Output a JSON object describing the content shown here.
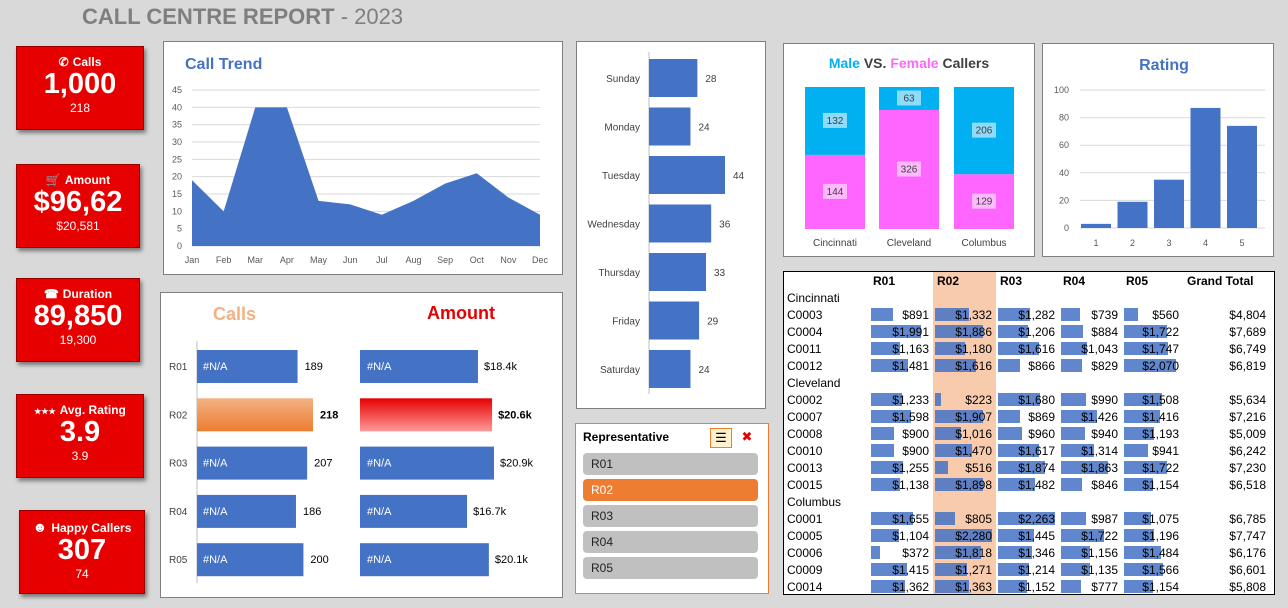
{
  "header": {
    "title": "CALL CENTRE REPORT",
    "sep": " - ",
    "year": "2023"
  },
  "kpis": [
    {
      "label": "Calls",
      "icon": "phone-icon",
      "glyph": "✆",
      "value": "1,000",
      "sub": "218"
    },
    {
      "label": "Amount",
      "icon": "cart-icon",
      "glyph": "🛒",
      "value": "$96,62",
      "sub": "$20,581"
    },
    {
      "label": "Duration",
      "icon": "agent-icon",
      "glyph": "☎",
      "value": "89,850",
      "sub": "19,300"
    },
    {
      "label": "Avg. Rating",
      "icon": "stars-icon",
      "glyph": "★★★",
      "value": "3.9",
      "sub": "3.9"
    },
    {
      "label": "Happy Callers",
      "icon": "smiley-icon",
      "glyph": "☻",
      "value": "307",
      "sub": "74"
    }
  ],
  "call_trend": {
    "title": "Call Trend",
    "months": [
      "Jan",
      "Feb",
      "Mar",
      "Apr",
      "May",
      "Jun",
      "Jul",
      "Aug",
      "Sep",
      "Oct",
      "Nov",
      "Dec"
    ],
    "values": [
      19,
      10,
      40,
      40,
      13,
      12,
      9,
      13,
      18,
      21,
      14,
      9
    ],
    "yticks": [
      "0",
      "5",
      "10",
      "15",
      "20",
      "25",
      "30",
      "35",
      "40",
      "45"
    ]
  },
  "weekday": {
    "days": [
      "Sunday",
      "Monday",
      "Tuesday",
      "Wednesday",
      "Thursday",
      "Friday",
      "Saturday"
    ],
    "values": [
      28,
      24,
      44,
      36,
      33,
      29,
      24
    ],
    "labels": [
      "28",
      "24",
      "44",
      "36",
      "33",
      "29",
      "24"
    ]
  },
  "gender": {
    "title_male": "Male",
    "title_vs": " VS. ",
    "title_female": "Female",
    "title_rest": " Callers",
    "cities": [
      "Cincinnati",
      "Cleveland",
      "Columbus"
    ],
    "male": [
      132,
      63,
      206
    ],
    "female": [
      144,
      326,
      129
    ],
    "male_labels": [
      "132",
      "63",
      "206"
    ],
    "female_labels": [
      "144",
      "326",
      "129"
    ],
    "colors": {
      "male": "#00b0f0",
      "female": "#ff66ff"
    }
  },
  "rating": {
    "title": "Rating",
    "categories": [
      "1",
      "2",
      "3",
      "4",
      "5"
    ],
    "values": [
      3,
      19,
      35,
      87,
      74
    ],
    "yticks": [
      "0",
      "20",
      "40",
      "60",
      "80",
      "100"
    ]
  },
  "rep": {
    "calls_title": "Calls",
    "amount_title": "Amount",
    "reps": [
      "R01",
      "R02",
      "R03",
      "R04",
      "R05"
    ],
    "calls": [
      189,
      218,
      207,
      186,
      200
    ],
    "calls_labels": [
      "189",
      "218",
      "207",
      "186",
      "200"
    ],
    "amount": [
      18.4,
      20.6,
      20.9,
      16.7,
      20.1
    ],
    "amount_labels": [
      "$18.4k",
      "$20.6k",
      "$20.9k",
      "$16.7k",
      "$20.1k"
    ],
    "na": "#N/A",
    "selected": 1
  },
  "slicer": {
    "title": "Representative",
    "items": [
      "R01",
      "R02",
      "R03",
      "R04",
      "R05"
    ],
    "selected": 1
  },
  "pivot": {
    "headers": [
      "R01",
      "R02",
      "R03",
      "R04",
      "R05",
      "Grand Total"
    ],
    "groups": [
      {
        "city": "Cincinnati",
        "rows": [
          {
            "id": "C0003",
            "vals": [
              "$891",
              "$1,332",
              "$1,282",
              "$739",
              "$560"
            ],
            "nums": [
              891,
              1332,
              1282,
              739,
              560
            ],
            "total": "$4,804"
          },
          {
            "id": "C0004",
            "vals": [
              "$1,991",
              "$1,886",
              "$1,206",
              "$884",
              "$1,722"
            ],
            "nums": [
              1991,
              1886,
              1206,
              884,
              1722
            ],
            "total": "$7,689"
          },
          {
            "id": "C0011",
            "vals": [
              "$1,163",
              "$1,180",
              "$1,616",
              "$1,043",
              "$1,747"
            ],
            "nums": [
              1163,
              1180,
              1616,
              1043,
              1747
            ],
            "total": "$6,749"
          },
          {
            "id": "C0012",
            "vals": [
              "$1,481",
              "$1,616",
              "$866",
              "$829",
              "$2,070"
            ],
            "nums": [
              1481,
              1616,
              866,
              829,
              2070
            ],
            "total": "$6,819"
          }
        ]
      },
      {
        "city": "Cleveland",
        "rows": [
          {
            "id": "C0002",
            "vals": [
              "$1,233",
              "$223",
              "$1,680",
              "$990",
              "$1,508"
            ],
            "nums": [
              1233,
              223,
              1680,
              990,
              1508
            ],
            "total": "$5,634"
          },
          {
            "id": "C0007",
            "vals": [
              "$1,598",
              "$1,907",
              "$869",
              "$1,426",
              "$1,416"
            ],
            "nums": [
              1598,
              1907,
              869,
              1426,
              1416
            ],
            "total": "$7,216"
          },
          {
            "id": "C0008",
            "vals": [
              "$900",
              "$1,016",
              "$960",
              "$940",
              "$1,193"
            ],
            "nums": [
              900,
              1016,
              960,
              940,
              1193
            ],
            "total": "$5,009"
          },
          {
            "id": "C0010",
            "vals": [
              "$900",
              "$1,470",
              "$1,617",
              "$1,314",
              "$941"
            ],
            "nums": [
              900,
              1470,
              1617,
              1314,
              941
            ],
            "total": "$6,242"
          },
          {
            "id": "C0013",
            "vals": [
              "$1,255",
              "$516",
              "$1,874",
              "$1,863",
              "$1,722"
            ],
            "nums": [
              1255,
              516,
              1874,
              1863,
              1722
            ],
            "total": "$7,230"
          },
          {
            "id": "C0015",
            "vals": [
              "$1,138",
              "$1,898",
              "$1,482",
              "$846",
              "$1,154"
            ],
            "nums": [
              1138,
              1898,
              1482,
              846,
              1154
            ],
            "total": "$6,518"
          }
        ]
      },
      {
        "city": "Columbus",
        "rows": [
          {
            "id": "C0001",
            "vals": [
              "$1,655",
              "$805",
              "$2,263",
              "$987",
              "$1,075"
            ],
            "nums": [
              1655,
              805,
              2263,
              987,
              1075
            ],
            "total": "$6,785"
          },
          {
            "id": "C0005",
            "vals": [
              "$1,104",
              "$2,280",
              "$1,445",
              "$1,722",
              "$1,196"
            ],
            "nums": [
              1104,
              2280,
              1445,
              1722,
              1196
            ],
            "total": "$7,747"
          },
          {
            "id": "C0006",
            "vals": [
              "$372",
              "$1,818",
              "$1,346",
              "$1,156",
              "$1,484"
            ],
            "nums": [
              372,
              1818,
              1346,
              1156,
              1484
            ],
            "total": "$6,176"
          },
          {
            "id": "C0009",
            "vals": [
              "$1,415",
              "$1,271",
              "$1,214",
              "$1,135",
              "$1,566"
            ],
            "nums": [
              1415,
              1271,
              1214,
              1135,
              1566
            ],
            "total": "$6,601"
          },
          {
            "id": "C0014",
            "vals": [
              "$1,362",
              "$1,363",
              "$1,152",
              "$777",
              "$1,154"
            ],
            "nums": [
              1362,
              1363,
              1152,
              777,
              1154
            ],
            "total": "$5,808"
          }
        ]
      }
    ]
  },
  "chart_data": [
    {
      "type": "area",
      "title": "Call Trend",
      "x": [
        "Jan",
        "Feb",
        "Mar",
        "Apr",
        "May",
        "Jun",
        "Jul",
        "Aug",
        "Sep",
        "Oct",
        "Nov",
        "Dec"
      ],
      "values": [
        19,
        10,
        40,
        40,
        13,
        12,
        9,
        13,
        18,
        21,
        14,
        9
      ],
      "ylim": [
        0,
        45
      ]
    },
    {
      "type": "bar",
      "orientation": "horizontal",
      "categories": [
        "Sunday",
        "Monday",
        "Tuesday",
        "Wednesday",
        "Thursday",
        "Friday",
        "Saturday"
      ],
      "values": [
        28,
        24,
        44,
        36,
        33,
        29,
        24
      ]
    },
    {
      "type": "bar",
      "stacked": true,
      "title": "Male VS. Female Callers",
      "categories": [
        "Cincinnati",
        "Cleveland",
        "Columbus"
      ],
      "series": [
        {
          "name": "Male",
          "values": [
            132,
            63,
            206
          ]
        },
        {
          "name": "Female",
          "values": [
            144,
            326,
            129
          ]
        }
      ]
    },
    {
      "type": "bar",
      "title": "Rating",
      "categories": [
        "1",
        "2",
        "3",
        "4",
        "5"
      ],
      "values": [
        3,
        19,
        35,
        87,
        74
      ],
      "ylim": [
        0,
        100
      ]
    },
    {
      "type": "bar",
      "orientation": "horizontal",
      "title": "Calls",
      "categories": [
        "R01",
        "R02",
        "R03",
        "R04",
        "R05"
      ],
      "values": [
        189,
        218,
        207,
        186,
        200
      ]
    },
    {
      "type": "bar",
      "orientation": "horizontal",
      "title": "Amount",
      "categories": [
        "R01",
        "R02",
        "R03",
        "R04",
        "R05"
      ],
      "values": [
        18.4,
        20.6,
        20.9,
        16.7,
        20.1
      ]
    }
  ]
}
